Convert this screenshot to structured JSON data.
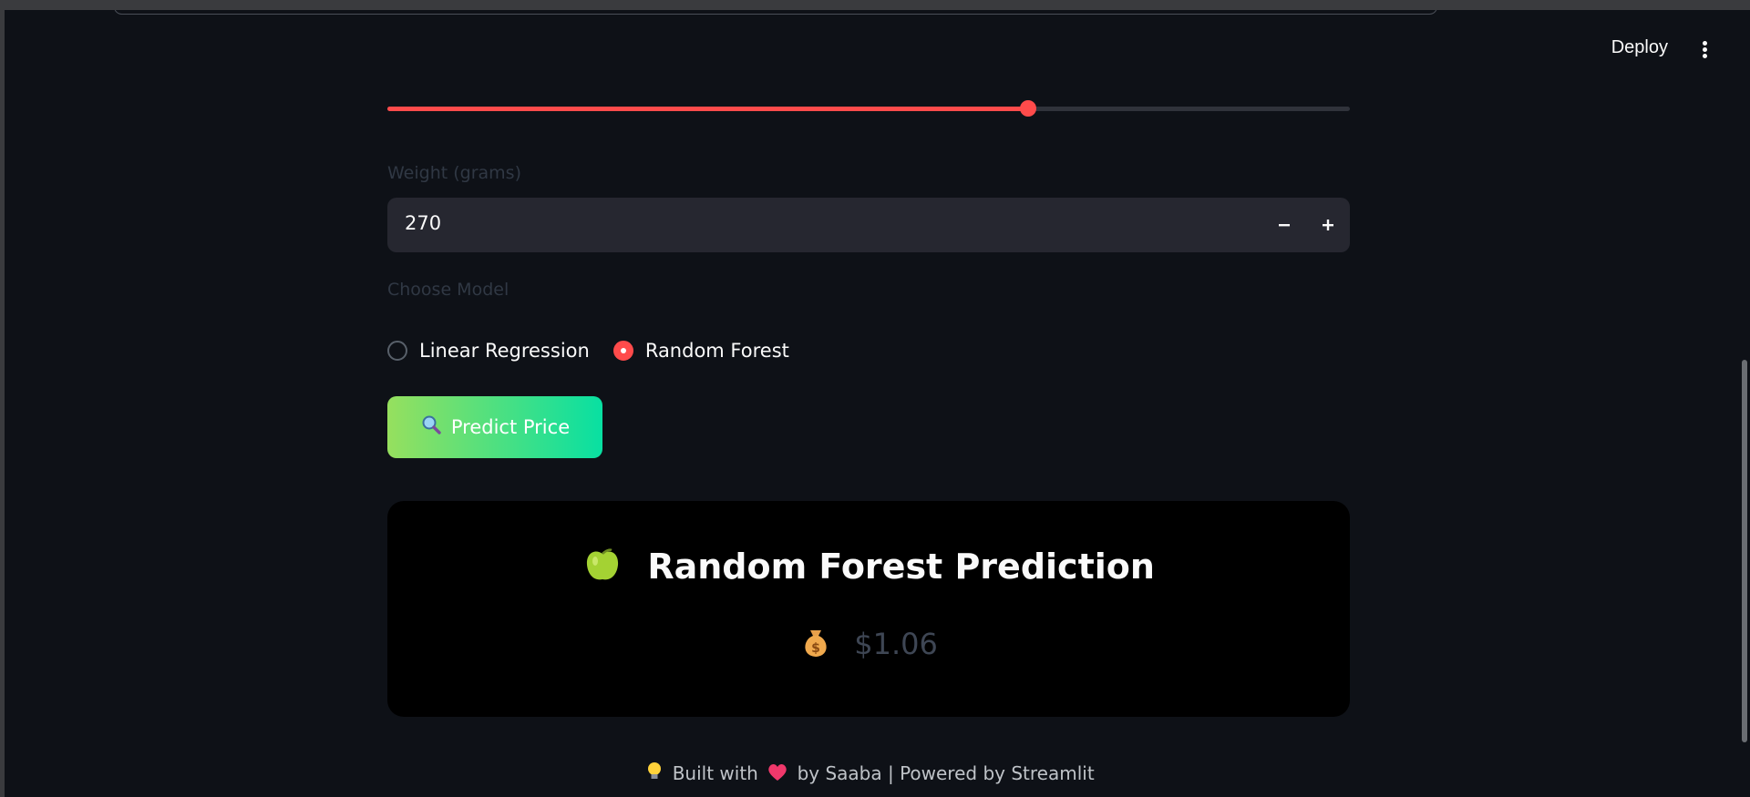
{
  "header": {
    "deploy_label": "Deploy",
    "menu_icon": "vertical-dots-icon"
  },
  "slider": {
    "value_fraction": 0.666,
    "accent": "#ff4b4b"
  },
  "weight": {
    "label": "Weight (grams)",
    "value": "270",
    "decrement_icon": "minus-icon",
    "increment_icon": "plus-icon"
  },
  "model": {
    "label": "Choose Model",
    "options": [
      {
        "label": "Linear Regression",
        "selected": false
      },
      {
        "label": "Random Forest",
        "selected": true
      }
    ]
  },
  "predict_button": {
    "icon": "magnifier-icon",
    "label": "Predict Price",
    "gradient": [
      "#96e05e",
      "#08e0a2"
    ]
  },
  "result": {
    "title": "Random Forest Prediction",
    "title_icon": "green-apple-icon",
    "price": "$1.06",
    "price_icon": "money-bag-icon"
  },
  "footer": {
    "built_with": "Built with",
    "by": "by Saaba | Powered by Streamlit",
    "bulb_icon": "light-bulb-icon",
    "heart_icon": "heart-icon"
  }
}
